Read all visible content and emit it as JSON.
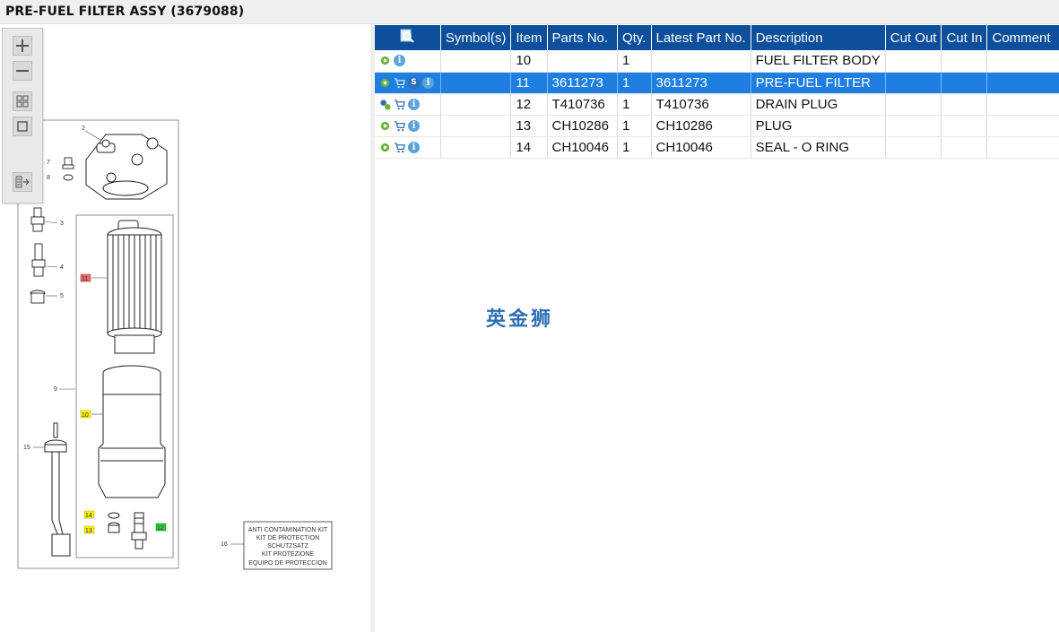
{
  "title": "PRE-FUEL FILTER ASSY (3679088)",
  "toolbox": {
    "icons": [
      "zoom-in-icon",
      "zoom-out-icon",
      "fit-grid-icon",
      "fit-page-icon",
      "export-panel-icon"
    ]
  },
  "drawing": {
    "callouts": [
      "2",
      "7",
      "8",
      "3",
      "4",
      "5",
      "11",
      "9",
      "10",
      "15",
      "14",
      "13",
      "12",
      "16"
    ],
    "kit_box_lines": [
      "ANTI CONTAMINATION KIT",
      "KIT DE PROTECTION",
      "SCHUTZSATZ",
      "KIT PROTEZIONE",
      "EQUIPO DE PROTECCION"
    ],
    "highlight_colors": {
      "red": "#e86b6b",
      "yellow": "#ffef00",
      "green": "#2ecc40"
    }
  },
  "table": {
    "header_color": "#0d4f9a",
    "selected_color": "#1e7fe0",
    "columns": [
      "Symbol(s)",
      "Item",
      "Parts No.",
      "Qty.",
      "Latest Part No.",
      "Description",
      "Cut Out",
      "Cut In",
      "Comment"
    ],
    "rows": [
      {
        "icons": [
          "gear-icon",
          "info-icon"
        ],
        "symbols": "",
        "item": "10",
        "part_no": "",
        "qty": "1",
        "latest": "",
        "description": "FUEL FILTER BODY",
        "cut_out": "",
        "cut_in": "",
        "comment": ""
      },
      {
        "icons": [
          "gear-icon",
          "cart-icon",
          "s-icon",
          "info-icon"
        ],
        "symbols": "",
        "item": "11",
        "part_no": "3611273",
        "qty": "1",
        "latest": "3611273",
        "description": "PRE-FUEL FILTER",
        "cut_out": "",
        "cut_in": "",
        "comment": "",
        "selected": true
      },
      {
        "icons": [
          "gears-icon",
          "cart-icon",
          "info-icon"
        ],
        "symbols": "",
        "item": "12",
        "part_no": "T410736",
        "qty": "1",
        "latest": "T410736",
        "description": "DRAIN PLUG",
        "cut_out": "",
        "cut_in": "",
        "comment": ""
      },
      {
        "icons": [
          "gear-icon",
          "cart-icon",
          "info-icon"
        ],
        "symbols": "",
        "item": "13",
        "part_no": "CH10286",
        "qty": "1",
        "latest": "CH10286",
        "description": "PLUG",
        "cut_out": "",
        "cut_in": "",
        "comment": ""
      },
      {
        "icons": [
          "gear-icon",
          "cart-icon",
          "info-icon"
        ],
        "symbols": "",
        "item": "14",
        "part_no": "CH10046",
        "qty": "1",
        "latest": "CH10046",
        "description": "SEAL - O RING",
        "cut_out": "",
        "cut_in": "",
        "comment": ""
      }
    ]
  },
  "watermark": "英金狮"
}
